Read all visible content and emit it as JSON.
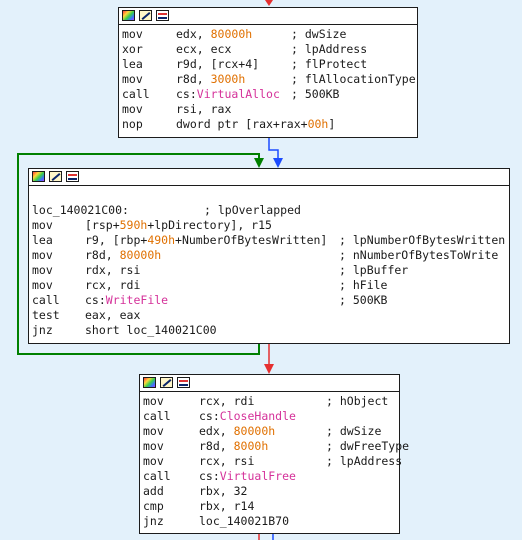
{
  "colors": {
    "background": "#e3f1fb",
    "edge_red": "#e53030",
    "edge_blue": "#1c4cff",
    "edge_green": "#008000",
    "immediate": "#e07000",
    "api": "#d5329a"
  },
  "blocks": [
    {
      "id": "block1",
      "lines": [
        {
          "mnem": "mov",
          "ops": [
            {
              "t": "edx, "
            },
            {
              "t": "80000h",
              "c": "num"
            }
          ],
          "cmt": "; dwSize"
        },
        {
          "mnem": "xor",
          "ops": [
            {
              "t": "ecx, ecx"
            }
          ],
          "cmt": "; lpAddress"
        },
        {
          "mnem": "lea",
          "ops": [
            {
              "t": "r9d, [rcx+4]"
            }
          ],
          "cmt": "; flProtect"
        },
        {
          "mnem": "mov",
          "ops": [
            {
              "t": "r8d, "
            },
            {
              "t": "3000h",
              "c": "num"
            }
          ],
          "cmt": "; flAllocationType"
        },
        {
          "mnem": "call",
          "ops": [
            {
              "t": "cs:"
            },
            {
              "t": "VirtualAlloc",
              "c": "api"
            }
          ],
          "cmt": "; 500KB"
        },
        {
          "mnem": "mov",
          "ops": [
            {
              "t": "rsi, rax"
            }
          ],
          "cmt": ""
        },
        {
          "mnem": "nop",
          "ops": [
            {
              "t": "dword ptr [rax+rax+"
            },
            {
              "t": "00h",
              "c": "num"
            },
            {
              "t": "]"
            }
          ],
          "cmt": ""
        }
      ]
    },
    {
      "id": "block2",
      "blank": true,
      "label": "loc_140021C00:",
      "label_cmt": "; lpOverlapped",
      "lines": [
        {
          "mnem": "mov",
          "ops": [
            {
              "t": "[rsp+"
            },
            {
              "t": "590h",
              "c": "num"
            },
            {
              "t": "+lpDirectory], r15"
            }
          ],
          "cmt": ""
        },
        {
          "mnem": "lea",
          "ops": [
            {
              "t": "r9, [rbp+"
            },
            {
              "t": "490h",
              "c": "num"
            },
            {
              "t": "+NumberOfBytesWritten]"
            }
          ],
          "cmt": "; lpNumberOfBytesWritten"
        },
        {
          "mnem": "mov",
          "ops": [
            {
              "t": "r8d, "
            },
            {
              "t": "80000h",
              "c": "num"
            }
          ],
          "cmt": "; nNumberOfBytesToWrite"
        },
        {
          "mnem": "mov",
          "ops": [
            {
              "t": "rdx, rsi"
            }
          ],
          "cmt": "; lpBuffer"
        },
        {
          "mnem": "mov",
          "ops": [
            {
              "t": "rcx, rdi"
            }
          ],
          "cmt": "; hFile"
        },
        {
          "mnem": "call",
          "ops": [
            {
              "t": "cs:"
            },
            {
              "t": "WriteFile",
              "c": "api"
            }
          ],
          "cmt": "; 500KB"
        },
        {
          "mnem": "test",
          "ops": [
            {
              "t": "eax, eax"
            }
          ],
          "cmt": ""
        },
        {
          "mnem": "jnz",
          "ops": [
            {
              "t": "short loc_140021C00"
            }
          ],
          "cmt": ""
        }
      ]
    },
    {
      "id": "block3",
      "lines": [
        {
          "mnem": "mov",
          "ops": [
            {
              "t": "rcx, rdi"
            }
          ],
          "cmt": "; hObject"
        },
        {
          "mnem": "call",
          "ops": [
            {
              "t": "cs:"
            },
            {
              "t": "CloseHandle",
              "c": "api"
            }
          ],
          "cmt": ""
        },
        {
          "mnem": "mov",
          "ops": [
            {
              "t": "edx, "
            },
            {
              "t": "80000h",
              "c": "num"
            }
          ],
          "cmt": "; dwSize"
        },
        {
          "mnem": "mov",
          "ops": [
            {
              "t": "r8d, "
            },
            {
              "t": "8000h",
              "c": "num"
            }
          ],
          "cmt": "; dwFreeType"
        },
        {
          "mnem": "mov",
          "ops": [
            {
              "t": "rcx, rsi"
            }
          ],
          "cmt": "; lpAddress"
        },
        {
          "mnem": "call",
          "ops": [
            {
              "t": "cs:"
            },
            {
              "t": "VirtualFree",
              "c": "api"
            }
          ],
          "cmt": ""
        },
        {
          "mnem": "add",
          "ops": [
            {
              "t": "rbx, 32"
            }
          ],
          "cmt": ""
        },
        {
          "mnem": "cmp",
          "ops": [
            {
              "t": "rbx, r14"
            }
          ],
          "cmt": ""
        },
        {
          "mnem": "jnz",
          "ops": [
            {
              "t": "loc_140021B70"
            }
          ],
          "cmt": ""
        }
      ]
    }
  ]
}
